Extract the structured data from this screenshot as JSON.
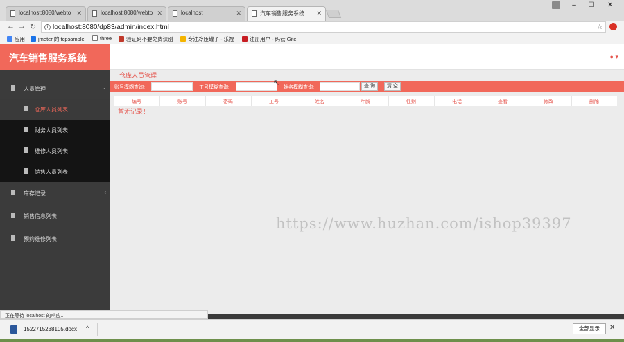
{
  "browser": {
    "tabs": [
      {
        "label": "localhost:8080/webto"
      },
      {
        "label": "localhost:8080/webto"
      },
      {
        "label": "localhost"
      },
      {
        "label": "汽车销售服务系统"
      }
    ],
    "url": "localhost:8080/dp83/admin/index.html",
    "bookmarks": [
      {
        "label": "应用",
        "color": "#4285f4"
      },
      {
        "label": "jmeter 的 tcpsample",
        "color": "#1a73e8"
      },
      {
        "label": "three",
        "color": "#ffffff"
      },
      {
        "label": "验证码不要免费识别",
        "color": "#c0392b"
      },
      {
        "label": "专注冷压罐子 - 乐视",
        "color": "#f4b400"
      },
      {
        "label": "注册用户 - 码云 Gite",
        "color": "#c71d23"
      }
    ]
  },
  "app": {
    "brand": "汽车销售服务系统",
    "sidebar": {
      "group_label": "人员管理",
      "sub_items": [
        {
          "label": "仓库人员列表"
        },
        {
          "label": "财务人员列表"
        },
        {
          "label": "维修人员列表"
        },
        {
          "label": "销售人员列表"
        }
      ],
      "items": [
        {
          "label": "库存记录"
        },
        {
          "label": "销售信息列表"
        },
        {
          "label": "预约维修列表"
        }
      ]
    },
    "panel_title": "仓库人员管理",
    "filters": {
      "f1_label": "账号模糊查询:",
      "f2_label": "工号模糊查询:",
      "f3_label": "姓名模糊查询:",
      "search_button": "查 询",
      "clear_button": "清 空"
    },
    "table": {
      "columns": [
        "编号",
        "账号",
        "密码",
        "工号",
        "姓名",
        "年龄",
        "性别",
        "电话",
        "查看",
        "修改",
        "删除"
      ]
    },
    "empty_text": "暂无记录！"
  },
  "watermark": "https://www.huzhan.com/ishop39397",
  "status_text": "正在等待 localhost 的响应...",
  "download": {
    "file_name": "1522715238105.docx",
    "show_all": "全部显示"
  }
}
